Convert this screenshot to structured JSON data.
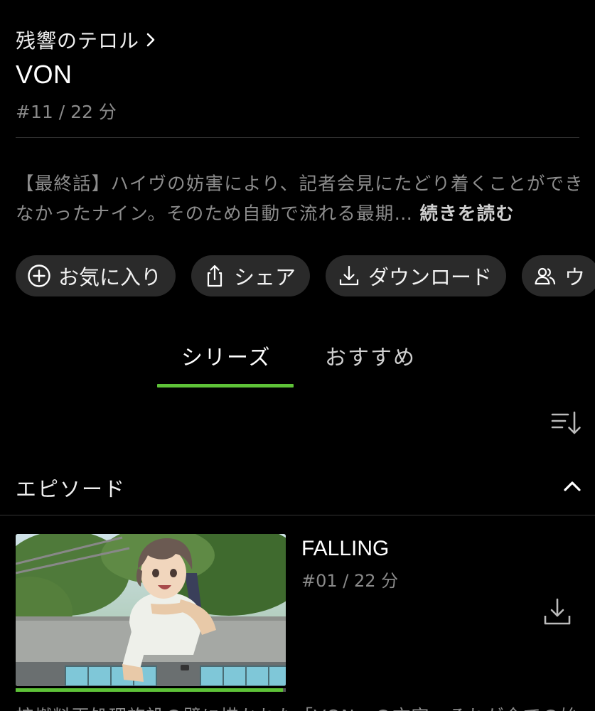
{
  "header": {
    "series_link": "残響のテロル",
    "title": "VON",
    "meta": "#11 / 22 分"
  },
  "synopsis": {
    "text": "【最終話】ハイヴの妨害により、記者会見にたどり着くことができなかったナイン。そのため自動で流れる最期…",
    "more_label": "続きを読む"
  },
  "actions": [
    {
      "label": "お気に入り",
      "icon": "plus-circle-icon"
    },
    {
      "label": "シェア",
      "icon": "share-icon"
    },
    {
      "label": "ダウンロード",
      "icon": "download-icon"
    },
    {
      "label": "ウ",
      "icon": "people-icon"
    }
  ],
  "tabs": {
    "series": "シリーズ",
    "recommended": "おすすめ",
    "active": "series"
  },
  "episodes_section": {
    "title": "エピソード",
    "sort_icon": "sort-descending-icon",
    "collapse_icon": "chevron-up-icon"
  },
  "episodes": [
    {
      "title": "FALLING",
      "meta": "#01 / 22 分",
      "progress": 0.99,
      "description": "核燃料再処理施設の壁に描かれた「VON」の文字。それが全ての始"
    }
  ],
  "colors": {
    "background": "#000000",
    "accent": "#5ec238",
    "pill_bg": "#2a2a2a",
    "muted_text": "#8c8c8c"
  }
}
